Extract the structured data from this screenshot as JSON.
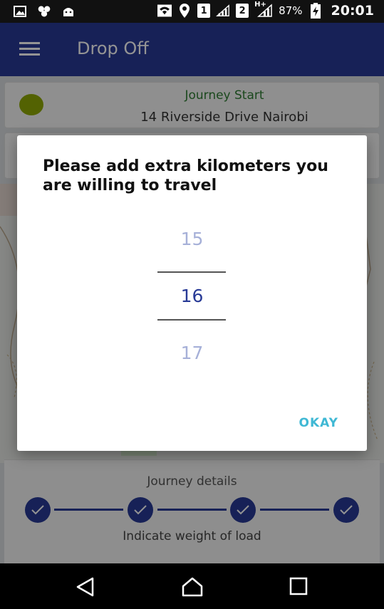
{
  "status_bar": {
    "sim1": "1",
    "sim2": "2",
    "network": "H+",
    "battery": "87%",
    "time": "20:01"
  },
  "app_bar": {
    "title": "Drop Off"
  },
  "journey_start": {
    "label": "Journey Start",
    "address": "14 Riverside Drive Nairobi"
  },
  "dialog": {
    "title": "Please add extra kilometers you are willing to travel",
    "picker": {
      "previous": "15",
      "selected": "16",
      "next": "17"
    },
    "okay_label": "OKAY"
  },
  "journey_panel": {
    "title": "Journey details",
    "steps_completed": 4,
    "subtitle": "Indicate weight of load"
  },
  "colors": {
    "primary": "#283a96",
    "accent": "#3fb8d4",
    "start_dot": "#8faa05",
    "start_label": "#2e7d32"
  }
}
